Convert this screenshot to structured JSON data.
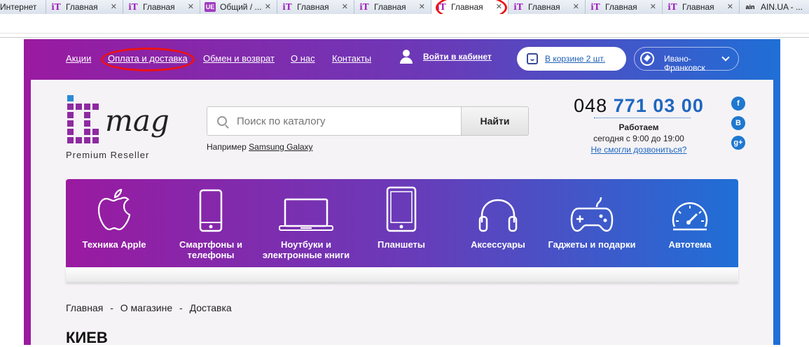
{
  "browser": {
    "tabs": [
      {
        "label": "Интернет",
        "icon": "",
        "active": false
      },
      {
        "label": "Главная",
        "icon": "iT",
        "active": false
      },
      {
        "label": "Главная",
        "icon": "iT",
        "active": false
      },
      {
        "label": "Общий / ...",
        "icon": "UE",
        "active": false
      },
      {
        "label": "Главная",
        "icon": "iT",
        "active": false
      },
      {
        "label": "Главная",
        "icon": "iT",
        "active": false
      },
      {
        "label": "Главная",
        "icon": "iT",
        "active": true
      },
      {
        "label": "Главная",
        "icon": "iT",
        "active": false
      },
      {
        "label": "Главная",
        "icon": "iT",
        "active": false
      },
      {
        "label": "Главная",
        "icon": "iT",
        "active": false
      },
      {
        "label": "AIN.UA - ...",
        "icon": "ain",
        "active": false
      }
    ],
    "close_glyph": "✕"
  },
  "topnav": {
    "links": [
      "Акции",
      "Оплата и доставка",
      "Обмен и возврат",
      "О нас",
      "Контакты"
    ],
    "login": "Войти в кабинет",
    "cart": "В корзине 2 шт.",
    "city": "Ивано-Франковск"
  },
  "logo": {
    "mark": "iT",
    "word": "mag",
    "tagline": "Premium Reseller"
  },
  "search": {
    "placeholder": "Поиск по каталогу",
    "button": "Найти",
    "example_prefix": "Например",
    "example_link": "Samsung Galaxy"
  },
  "contact": {
    "code": "048",
    "number": "771 03 00",
    "status": "Работаем",
    "hours": "сегодня с 9:00 до 19:00",
    "callback": "Не смогли дозвониться?"
  },
  "social": [
    "f",
    "B",
    "g+"
  ],
  "categories": [
    {
      "label": "Техника Apple",
      "icon": "apple-icon"
    },
    {
      "label": "Смартфоны и телефоны",
      "icon": "smartphone-icon"
    },
    {
      "label": "Ноутбуки и электронные книги",
      "icon": "laptop-icon"
    },
    {
      "label": "Планшеты",
      "icon": "tablet-icon"
    },
    {
      "label": "Аксессуары",
      "icon": "headphones-icon"
    },
    {
      "label": "Гаджеты и подарки",
      "icon": "gamepad-icon"
    },
    {
      "label": "Автотема",
      "icon": "speedometer-icon"
    }
  ],
  "breadcrumb": [
    "Главная",
    "-",
    "О магазине",
    "-",
    "Доставка"
  ],
  "page_heading": "КИЕВ",
  "colors": {
    "accent_purple": "#9a1aa0",
    "accent_blue": "#1f6fd6",
    "phone_blue": "#1f66c0",
    "annotation_red": "#ee1111"
  }
}
